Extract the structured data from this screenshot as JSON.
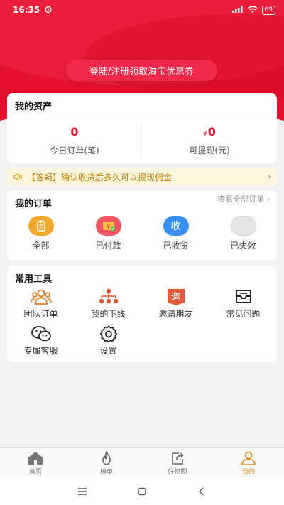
{
  "status": {
    "time": "16:35",
    "battery": "69"
  },
  "promo": {
    "label": "登陆/注册领取淘宝优惠券"
  },
  "assets": {
    "title": "我的资产",
    "today_orders": {
      "value": "0",
      "label": "今日订单(笔)"
    },
    "withdrawable": {
      "currency": "¥",
      "value": "0",
      "label": "可提现(元)"
    }
  },
  "notice": {
    "text": "【答疑】确认收货后多久可以提现佣金",
    "arrow": "›"
  },
  "orders": {
    "title": "我的订单",
    "more": "查看全部订单",
    "more_arrow": "›",
    "items": [
      {
        "label": "全部",
        "color": "#f0a92e"
      },
      {
        "label": "已付款",
        "color": "#f35462",
        "glyph": "¥"
      },
      {
        "label": "已收货",
        "color": "#3a8ff0",
        "glyph": "收"
      },
      {
        "label": "已失效",
        "color": "#e6e6e6"
      }
    ]
  },
  "tools": {
    "title": "常用工具",
    "items": [
      {
        "label": "团队订单",
        "icon": "team-icon"
      },
      {
        "label": "我的下线",
        "icon": "org-chart-icon"
      },
      {
        "label": "邀请朋友",
        "icon": "invite-icon",
        "glyph": "邀"
      },
      {
        "label": "常见问题",
        "icon": "faq-box-icon"
      },
      {
        "label": "专属客服",
        "icon": "wechat-service-icon"
      },
      {
        "label": "设置",
        "icon": "gear-icon"
      }
    ]
  },
  "tabbar": {
    "tabs": [
      {
        "label": "首页",
        "icon": "home-icon"
      },
      {
        "label": "榜单",
        "icon": "flame-icon"
      },
      {
        "label": "好物圈",
        "icon": "share-icon"
      },
      {
        "label": "我的",
        "icon": "user-icon",
        "active": true
      }
    ]
  },
  "colors": {
    "brand_red": "#e4102e",
    "accent_orange": "#e08a1e"
  }
}
